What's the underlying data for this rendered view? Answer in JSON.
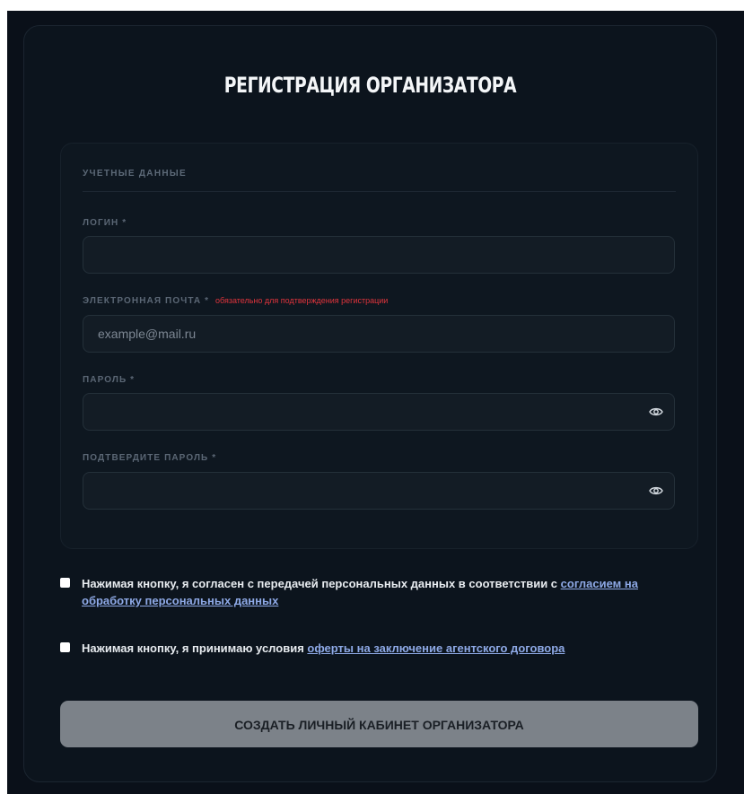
{
  "page": {
    "title": "РЕГИСТРАЦИЯ ОРГАНИЗАТОРА"
  },
  "section": {
    "title": "УЧЕТНЫЕ ДАННЫЕ"
  },
  "fields": {
    "login": {
      "label": "ЛОГИН *",
      "value": "",
      "placeholder": ""
    },
    "email": {
      "label": "ЭЛЕКТРОННАЯ ПОЧТА *",
      "note": "обязательно для подтверждения регистрации",
      "value": "",
      "placeholder": "example@mail.ru"
    },
    "password": {
      "label": "ПАРОЛЬ *",
      "value": "",
      "placeholder": "",
      "toggle_icon": "eye-icon"
    },
    "confirm_password": {
      "label": "ПОДТВЕРДИТЕ ПАРОЛЬ *",
      "value": "",
      "placeholder": "",
      "toggle_icon": "eye-icon"
    }
  },
  "consents": {
    "personal_data": {
      "checked": false,
      "text": "Нажимая кнопку, я согласен с передачей персональных данных в соответствии с ",
      "link_text": "согласием на обработку персональных данных"
    },
    "offer": {
      "checked": false,
      "text": "Нажимая кнопку, я принимаю условия ",
      "link_text": "оферты на заключение агентского договора"
    }
  },
  "submit": {
    "label": "СОЗДАТЬ ЛИЧНЫЙ КАБИНЕТ ОРГАНИЗАТОРА"
  },
  "colors": {
    "background": "#0a1019",
    "card": "#0c141d",
    "input": "#131c25",
    "required_note": "#e0343c",
    "link": "#8ea9e6",
    "button_disabled": "#7c8289"
  }
}
